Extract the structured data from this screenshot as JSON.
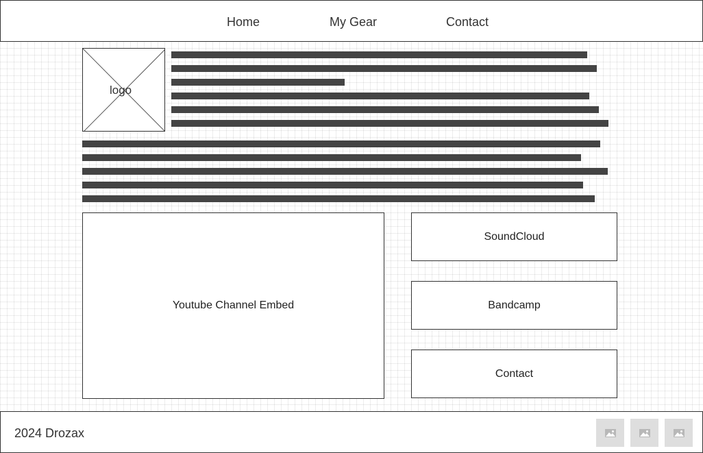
{
  "header": {
    "nav": [
      {
        "label": "Home"
      },
      {
        "label": "My Gear"
      },
      {
        "label": "Contact"
      }
    ]
  },
  "logo": {
    "label": "logo"
  },
  "main": {
    "youtube_label": "Youtube Channel Embed",
    "links": [
      {
        "label": "SoundCloud"
      },
      {
        "label": "Bandcamp"
      },
      {
        "label": "Contact"
      }
    ]
  },
  "footer": {
    "copyright": "2024 Drozax",
    "social_icons": [
      "image-icon",
      "image-icon",
      "image-icon"
    ]
  }
}
